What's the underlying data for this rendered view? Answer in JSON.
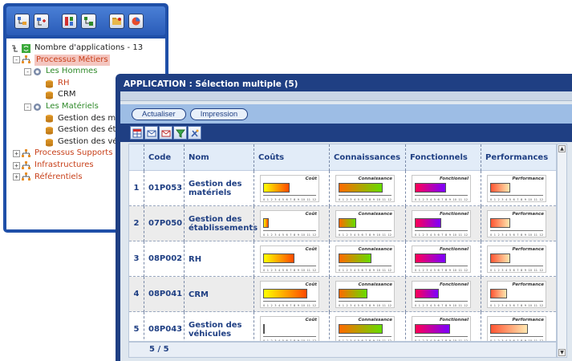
{
  "tree": {
    "root_label": "Nombre d'applications - 13",
    "nodes": [
      {
        "label": "Processus Métiers",
        "expander": "-",
        "selected": true
      },
      {
        "label": "Les Hommes",
        "expander": "-"
      },
      {
        "label": "RH"
      },
      {
        "label": "CRM"
      },
      {
        "label": "Les Matériels",
        "expander": "-"
      },
      {
        "label": "Gestion des ma"
      },
      {
        "label": "Gestion des éta"
      },
      {
        "label": "Gestion des vé"
      },
      {
        "label": "Processus Supports",
        "expander": "+"
      },
      {
        "label": "Infrastructures",
        "expander": "+"
      },
      {
        "label": "Référentiels",
        "expander": "+"
      }
    ]
  },
  "app": {
    "title": "APPLICATION : Sélection multiple (5)",
    "buttons": {
      "refresh": "Actualiser",
      "print": "Impression"
    },
    "columns": [
      "Code",
      "Nom",
      "Coûts",
      "Connaissances",
      "Fonctionnels",
      "Performances"
    ],
    "chart_titles": {
      "cout": "Coût",
      "conn": "Connaissance",
      "fonc": "Fonctionnel",
      "perf": "Performance"
    },
    "tick_labels": [
      "0",
      "1",
      "2",
      "3",
      "4",
      "5",
      "6",
      "7",
      "8",
      "9",
      "10",
      "11",
      "12"
    ],
    "rows": [
      {
        "n": "1",
        "code": "01P053",
        "name": "Gestion des matériels",
        "cout": 6,
        "conn": 10,
        "fonc": 7,
        "perf": 4.5
      },
      {
        "n": "2",
        "code": "07P050",
        "name": "Gestion des établissements",
        "cout": 1.3,
        "conn": 4,
        "fonc": 6,
        "perf": 4.5
      },
      {
        "n": "3",
        "code": "08P002",
        "name": "RH",
        "cout": 7,
        "conn": 7.5,
        "fonc": 7,
        "perf": 4.5
      },
      {
        "n": "4",
        "code": "08P041",
        "name": "CRM",
        "cout": 10,
        "conn": 6.5,
        "fonc": 5.5,
        "perf": 3.8
      },
      {
        "n": "5",
        "code": "08P043",
        "name": "Gestion des véhicules",
        "cout": 0.2,
        "conn": 10,
        "fonc": 8,
        "perf": 8.5
      }
    ],
    "pager": "5 / 5"
  }
}
